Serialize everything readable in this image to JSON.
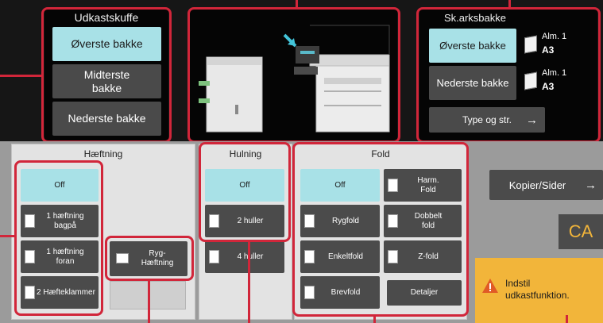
{
  "exit_tray": {
    "title": "Udkastskuffe",
    "buttons": [
      "Øverste bakke",
      "Midterste\nbakke",
      "Nederste bakke"
    ]
  },
  "preview": {
    "label": "machine-preview"
  },
  "sheet_tray": {
    "title": "Sk.arksbakke",
    "upper": {
      "label": "Øverste bakke",
      "paper_type": "Alm. 1",
      "paper_size": "A3"
    },
    "lower": {
      "label": "Nederste bakke",
      "paper_type": "Alm. 1",
      "paper_size": "A3"
    },
    "type_size_button": "Type og str."
  },
  "stapling": {
    "title": "Hæftning",
    "options": [
      "Off",
      "1 hæftning\nbagpå",
      "1 hæftning\nforan",
      "2 Hæfteklammer"
    ],
    "saddle": "Ryg-\nHæftning"
  },
  "punch": {
    "title": "Hulning",
    "options": [
      "Off",
      "2 huller",
      "4 huller"
    ]
  },
  "fold": {
    "title": "Fold",
    "options": [
      "Off",
      "Harm.\nFold",
      "Rygfold",
      "Dobbelt\nfold",
      "Enkeltfold",
      "Z-fold",
      "Brevfold"
    ],
    "details": "Detaljer"
  },
  "copies_pages_button": "Kopier/Sider",
  "ca_button": "CA",
  "warning": {
    "text": "Indstil\nudkastfunktion.",
    "color": "#f2b53a"
  },
  "colors": {
    "accent": "#a8e1e7",
    "callout": "#d1263a"
  }
}
